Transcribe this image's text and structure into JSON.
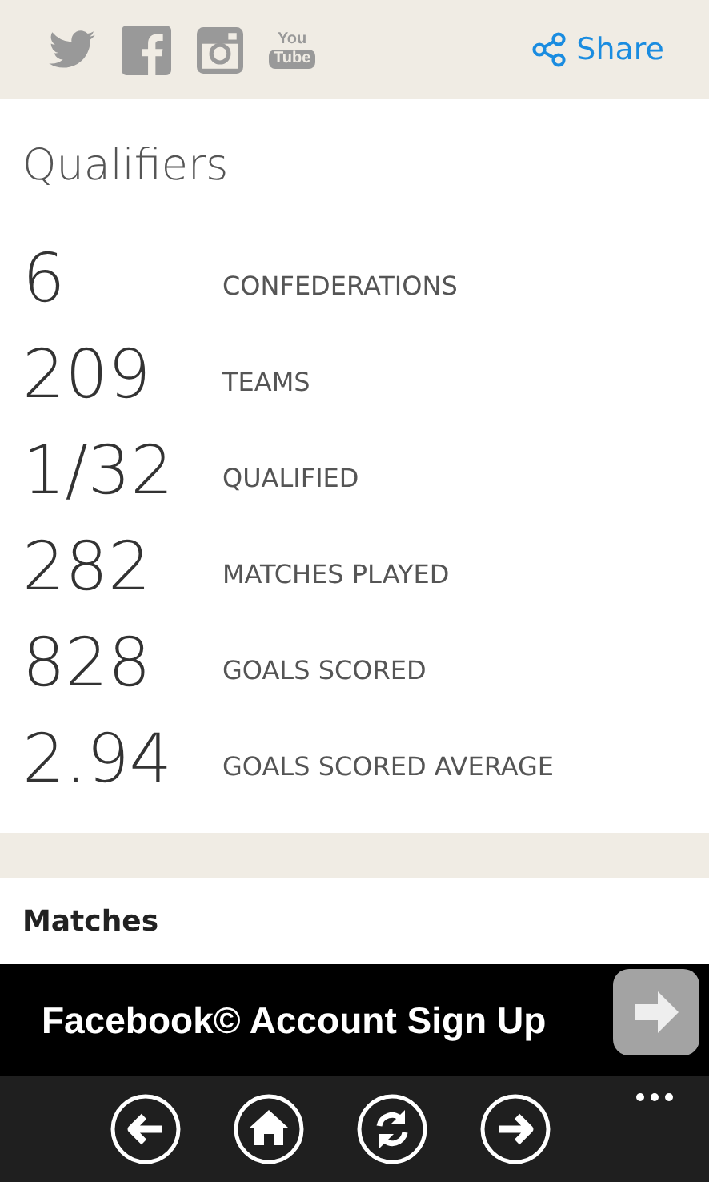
{
  "share_bar": {
    "youtube_logo": {
      "top": "You",
      "bottom": "Tube"
    },
    "share_label": "Share"
  },
  "qualifiers": {
    "title": "Qualifiers",
    "stats": [
      {
        "value": "6",
        "label": "CONFEDERATIONS"
      },
      {
        "value": "209",
        "label": "TEAMS"
      },
      {
        "value": "1/32",
        "label": "QUALIFIED"
      },
      {
        "value": "282",
        "label": "MATCHES PLAYED"
      },
      {
        "value": "828",
        "label": "GOALS SCORED"
      },
      {
        "value": "2.94",
        "label": "GOALS SCORED AVERAGE"
      }
    ]
  },
  "matches": {
    "title": "Matches"
  },
  "ad_banner": {
    "text": "Facebook© Account Sign Up"
  },
  "app_bar": {
    "buttons": [
      {
        "kind": "back"
      },
      {
        "kind": "home"
      },
      {
        "kind": "refresh"
      },
      {
        "kind": "forward"
      }
    ]
  }
}
